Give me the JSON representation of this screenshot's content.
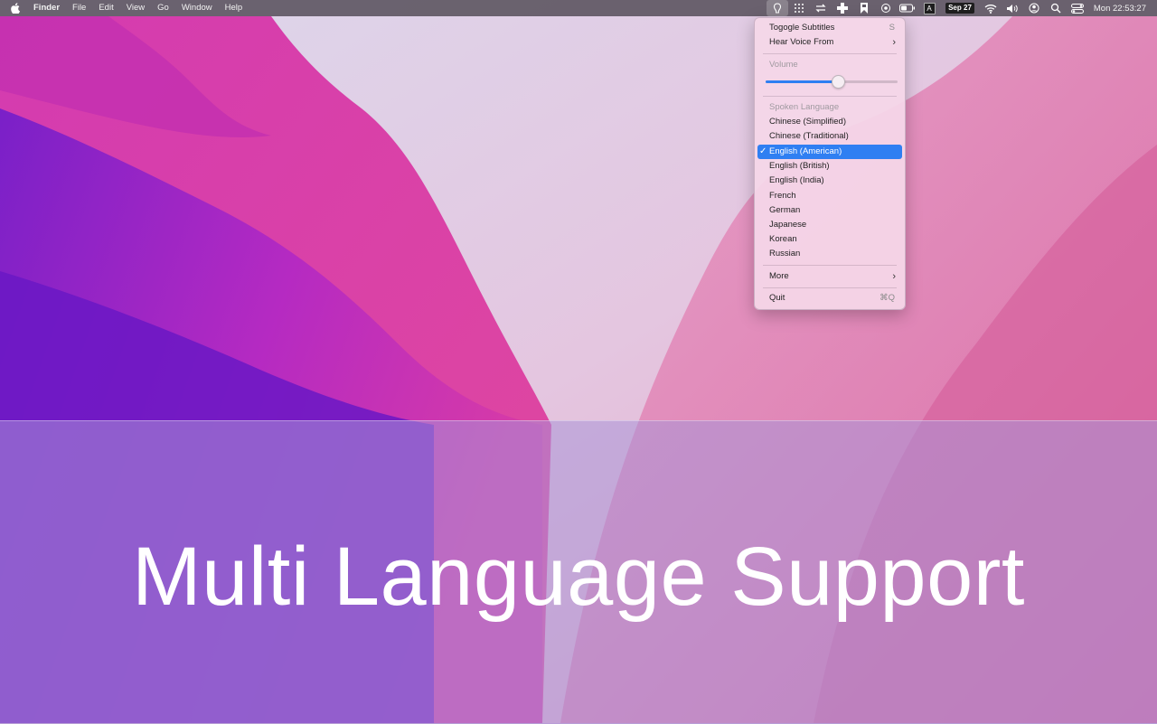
{
  "menubar": {
    "app_name": "Finder",
    "menus": [
      "File",
      "Edit",
      "View",
      "Go",
      "Window",
      "Help"
    ],
    "status_icons": [
      "voice-status-icon",
      "grid-icon",
      "transfer-icon",
      "cross-icon",
      "bookmark-icon",
      "record-icon",
      "battery-icon",
      "input-source-icon"
    ],
    "input_source": "A",
    "date_badge": "Sep 27",
    "clock": "Mon 22:53:27"
  },
  "dropdown": {
    "toggle_subtitles": {
      "label": "Togogle Subtitles",
      "shortcut": "S"
    },
    "hear_voice_from": {
      "label": "Hear Voice From"
    },
    "volume": {
      "label": "Volume",
      "value": 0.55
    },
    "spoken_language_header": "Spoken Language",
    "languages": [
      {
        "label": "Chinese (Simplified)"
      },
      {
        "label": "Chinese (Traditional)"
      },
      {
        "label": "English (American)",
        "checkmark": "✓"
      },
      {
        "label": "English (British)"
      },
      {
        "label": "English (India)"
      },
      {
        "label": "French"
      },
      {
        "label": "German"
      },
      {
        "label": "Japanese"
      },
      {
        "label": "Korean"
      },
      {
        "label": "Russian"
      }
    ],
    "more": {
      "label": "More"
    },
    "quit": {
      "label": "Quit",
      "shortcut": "⌘Q"
    },
    "accent_color": "#2f7ff2"
  },
  "banner": {
    "title": "Multi Language Support"
  }
}
